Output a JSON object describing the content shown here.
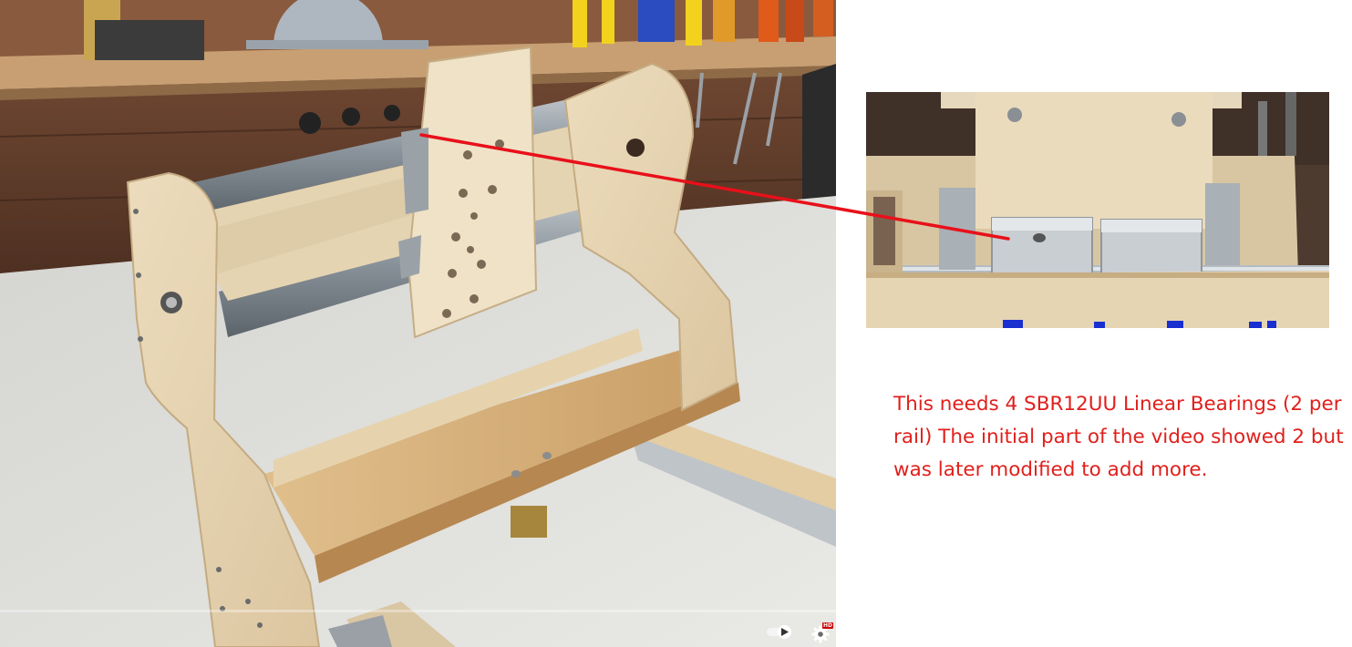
{
  "annotation": {
    "note": "This needs 4 SBR12UU Linear Bearings (2 per rail) The initial part of the video showed 2 but was later modified to add more.",
    "color": "#e0201c"
  },
  "video_player": {
    "progress": 0.055,
    "autoplay": "on",
    "settings_badge": "HD",
    "icons": [
      "autoplay-toggle-icon",
      "settings-gear-icon"
    ]
  },
  "inset_image": {
    "subject": "zoomed view of linear bearing blocks on rail"
  },
  "colors": {
    "pointer_line": "#e8101a",
    "progress_fill": "#e8e8e8",
    "hd_badge": "#cc0000"
  }
}
